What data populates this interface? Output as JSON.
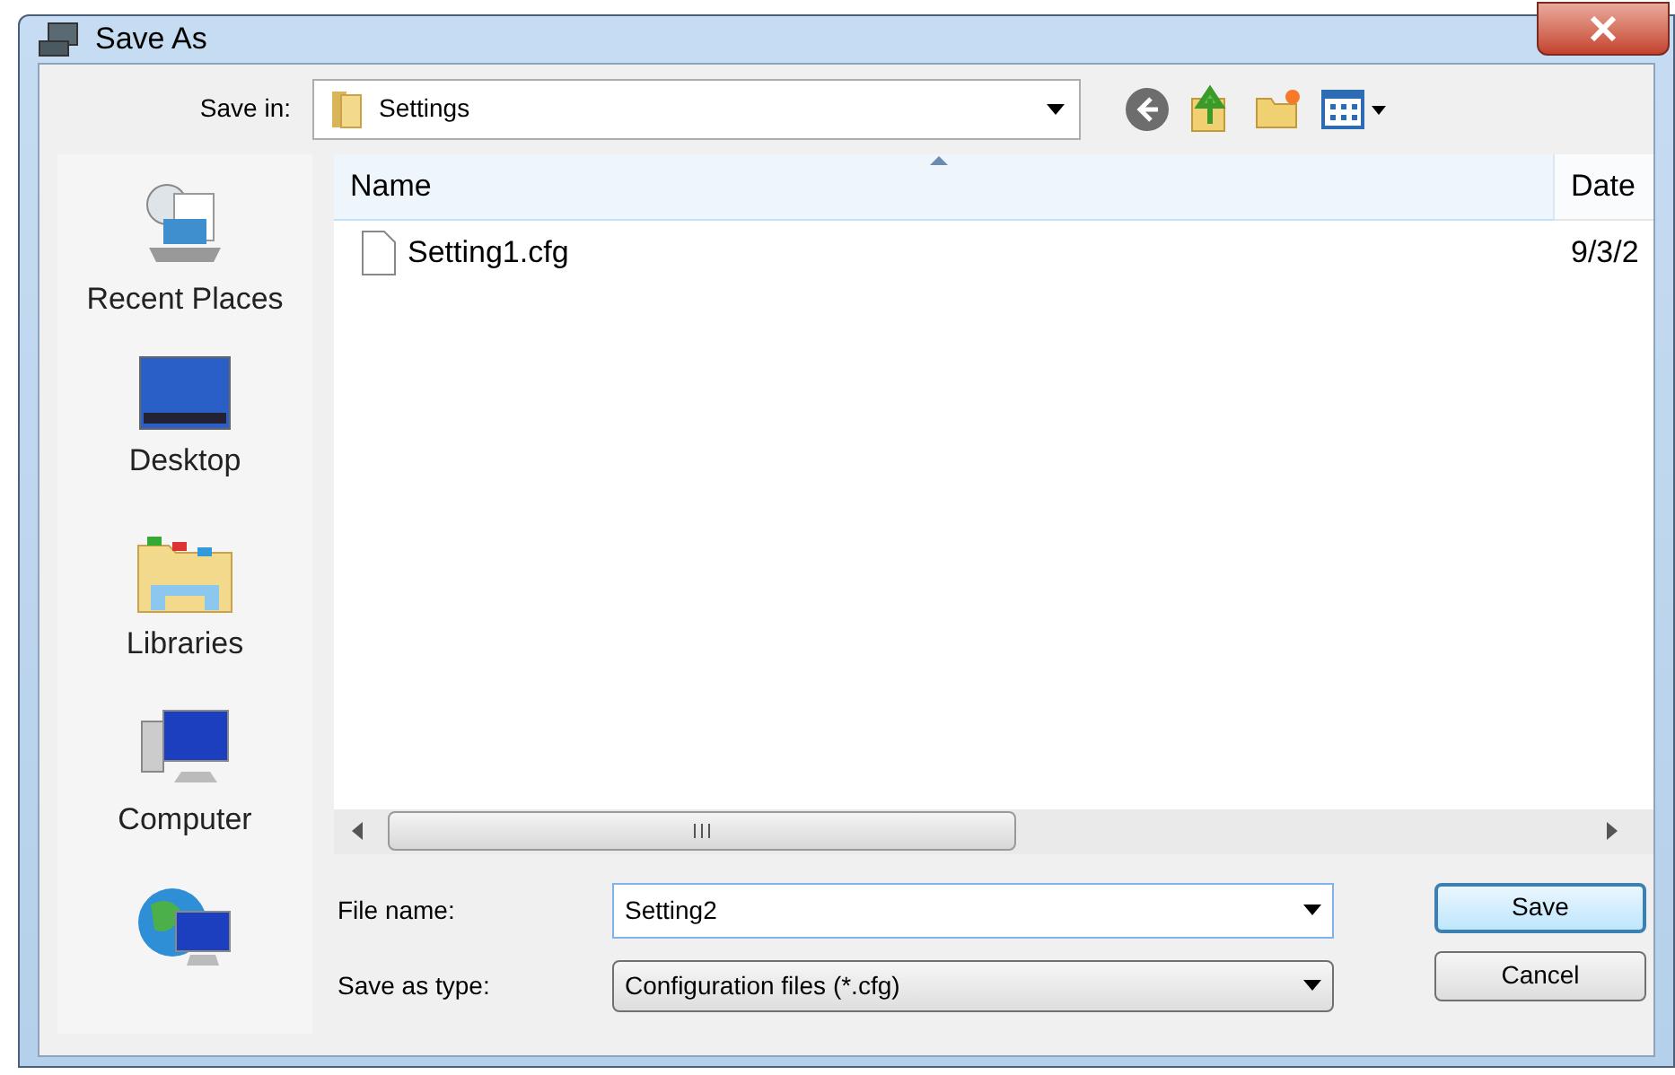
{
  "window": {
    "title": "Save As"
  },
  "save_in": {
    "label": "Save in:",
    "value": "Settings"
  },
  "places": [
    {
      "kind": "recent",
      "label": "Recent Places"
    },
    {
      "kind": "desktop",
      "label": "Desktop"
    },
    {
      "kind": "libraries",
      "label": "Libraries"
    },
    {
      "kind": "computer",
      "label": "Computer"
    },
    {
      "kind": "network"
    }
  ],
  "table": {
    "columns": [
      "Name",
      "Date"
    ],
    "rows": [
      {
        "name": "Setting1.cfg",
        "date": "9/3/2"
      }
    ]
  },
  "file_name": {
    "label": "File name:",
    "value": "Setting2"
  },
  "save_as_type": {
    "label": "Save as type:",
    "value": "Configuration files (*.cfg)"
  },
  "buttons": [
    {
      "label": "Save",
      "default": true
    },
    {
      "label": "Cancel",
      "default": false
    }
  ]
}
